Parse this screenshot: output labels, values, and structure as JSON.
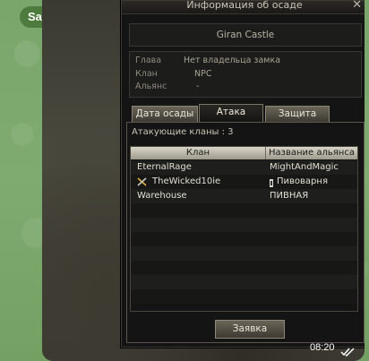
{
  "chat": {
    "date_label": "Saturday",
    "message_time": "08:20",
    "read_icon": "double-check-icon"
  },
  "window": {
    "title": "Информация об осаде",
    "close_icon": "close-icon"
  },
  "castle": {
    "name": "Giran Castle"
  },
  "info": {
    "head_label": "Глава",
    "head_value": "Нет владельца замка",
    "clan_label": "Клан",
    "clan_value": "NPC",
    "alliance_label": "Альянс",
    "alliance_value": "-"
  },
  "tabs": [
    {
      "label": "Дата осады",
      "active": false
    },
    {
      "label": "Атака",
      "active": true
    },
    {
      "label": "Защита",
      "active": false
    }
  ],
  "attack": {
    "count_text": "Атакующие кланы : 3",
    "columns": [
      "Клан",
      "Название альянса"
    ],
    "rows": [
      {
        "clan": "EternalRage",
        "alliance": "MightAndMagic",
        "clan_icon": "",
        "alliance_icon": ""
      },
      {
        "clan": "TheWicked10ie",
        "alliance": "Пивоварня",
        "clan_icon": "crossed-swords-icon",
        "alliance_icon": "alliance-crest-icon"
      },
      {
        "clan": "Warehouse",
        "alliance": "ПИВНАЯ",
        "clan_icon": "",
        "alliance_icon": ""
      }
    ],
    "submit_label": "Заявка"
  }
}
